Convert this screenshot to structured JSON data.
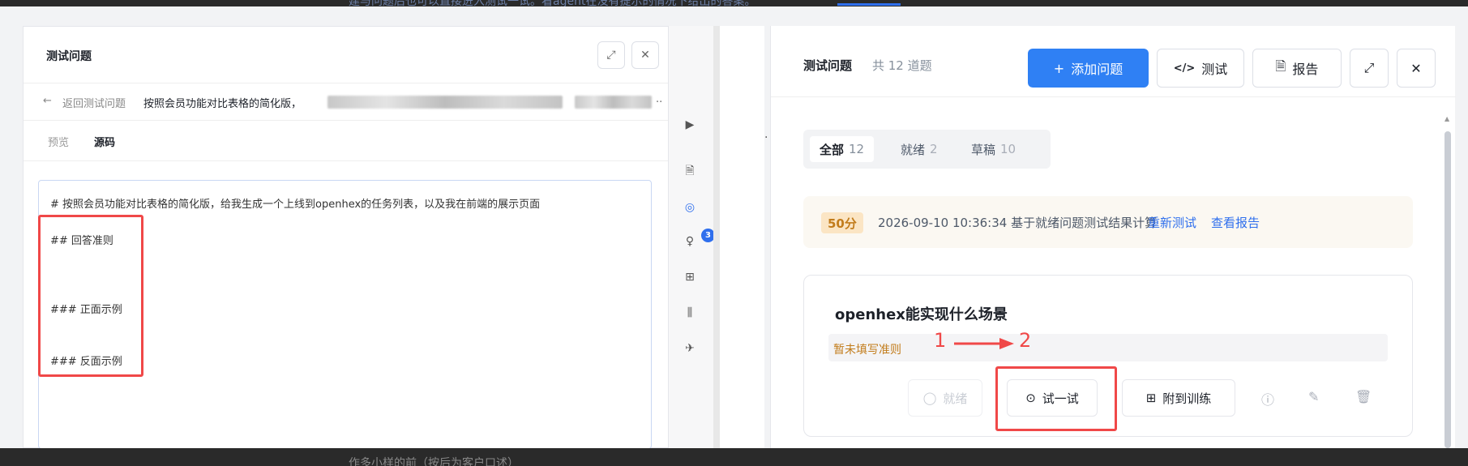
{
  "top_fragment": "建与问题后也可以直接进入测试一试。看agent在没有提示的情况下给出的答案。",
  "bottom_fragment": "作多小样的前（按后为客户口述）",
  "left_panel": {
    "title": "测试问题",
    "back_label": "返回测试问题",
    "question_title": "按照会员功能对比表格的简化版，",
    "ellipsis": "..",
    "tabs": [
      "预览",
      "源码"
    ],
    "editor_lines": [
      "# 按照会员功能对比表格的简化版，给我生成一个上线到openhex的任务列表，以及我在前端的展示页面",
      "## 回答准则",
      "### 正面示例",
      "### 反面示例"
    ]
  },
  "rail": {
    "badge": "3"
  },
  "right_panel": {
    "title": "测试问题",
    "count_text": "共 12 道题",
    "add_button": "添加问题",
    "test_button": "测试",
    "report_button": "报告",
    "filters": [
      {
        "label": "全部",
        "count": "12"
      },
      {
        "label": "就绪",
        "count": "2"
      },
      {
        "label": "草稿",
        "count": "10"
      }
    ],
    "score": "50分",
    "score_info": "2026-09-10 10:36:34 基于就绪问题测试结果计算",
    "retest_link": "重新测试",
    "view_report_link": "查看报告",
    "card": {
      "question": "openhex能实现什么场景",
      "rule_placeholder": "暂未填写准则",
      "ready_button": "就绪",
      "try_button": "试一试",
      "attach_button": "附到训练"
    }
  },
  "annotations": {
    "step1": "1",
    "step2": "2"
  },
  "colors": {
    "accent": "#2f80f4",
    "annotation_red": "#f04848",
    "score_bg": "#fbe5c4"
  }
}
